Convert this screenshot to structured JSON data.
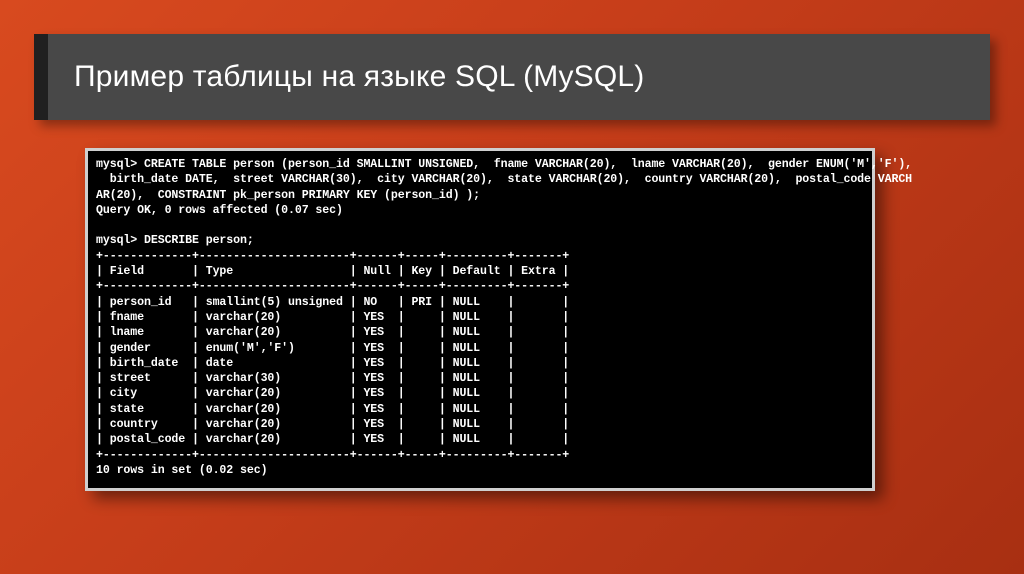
{
  "slide": {
    "title": "Пример таблицы на языке SQL (MySQL)"
  },
  "terminal": {
    "prompt": "mysql>",
    "create_stmt": "mysql> CREATE TABLE person (person_id SMALLINT UNSIGNED,  fname VARCHAR(20),  lname VARCHAR(20),  gender ENUM('M','F'),\n  birth_date DATE,  street VARCHAR(30),  city VARCHAR(20),  state VARCHAR(20),  country VARCHAR(20),  postal_code VARCH\nAR(20),  CONSTRAINT pk_person PRIMARY KEY (person_id) );",
    "create_result": "Query OK, 0 rows affected (0.07 sec)",
    "describe_cmd": "mysql> DESCRIBE person;",
    "divider": "+-------------+----------------------+------+-----+---------+-------+",
    "header": "| Field       | Type                 | Null | Key | Default | Extra |",
    "rows": [
      "| person_id   | smallint(5) unsigned | NO   | PRI | NULL    |       |",
      "| fname       | varchar(20)          | YES  |     | NULL    |       |",
      "| lname       | varchar(20)          | YES  |     | NULL    |       |",
      "| gender      | enum('M','F')        | YES  |     | NULL    |       |",
      "| birth_date  | date                 | YES  |     | NULL    |       |",
      "| street      | varchar(30)          | YES  |     | NULL    |       |",
      "| city        | varchar(20)          | YES  |     | NULL    |       |",
      "| state       | varchar(20)          | YES  |     | NULL    |       |",
      "| country     | varchar(20)          | YES  |     | NULL    |       |",
      "| postal_code | varchar(20)          | YES  |     | NULL    |       |"
    ],
    "footer": "10 rows in set (0.02 sec)"
  }
}
